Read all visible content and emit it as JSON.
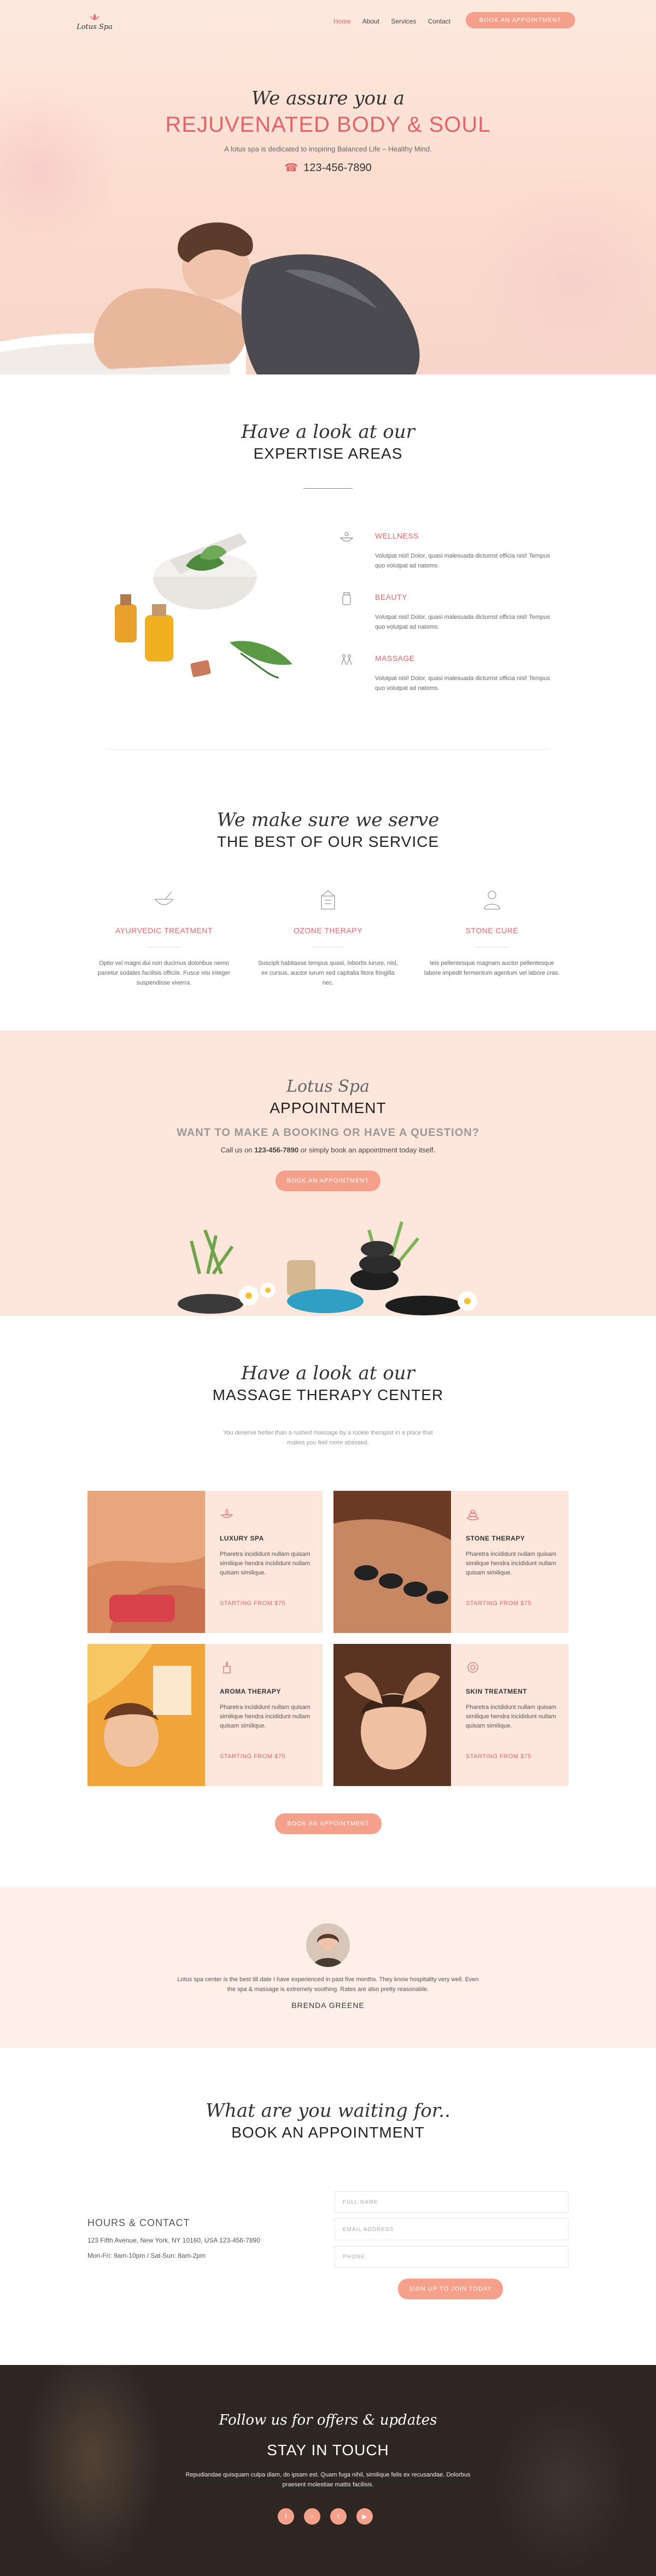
{
  "nav": {
    "logo_text": "Lotus Spa",
    "links": [
      "Home",
      "About",
      "Services",
      "Contact"
    ],
    "cta": "BOOK AN APPOINTMENT"
  },
  "hero": {
    "script": "We assure you a",
    "title": "REJUVENATED BODY & SOUL",
    "tagline": "A lotus spa is dedicated to inspiring Balanced Life – Healthy Mind.",
    "phone": "123-456-7890"
  },
  "expertise": {
    "script": "Have a look at our",
    "title": "EXPERTISE AREAS",
    "items": [
      {
        "title": "WELLNESS",
        "text": "Volutpat nisl! Dolor, quasi malesuada dictumst officia nisl! Tempus quo volutpat ad natoms."
      },
      {
        "title": "BEAUTY",
        "text": "Volutpat nisl! Dolor, quasi malesuada dictumst officia nisl! Tempus quo volutpat ad natoms."
      },
      {
        "title": "MASSAGE",
        "text": "Volutpat nisl! Dolor, quasi malesuada dictumst officia nisl! Tempus quo volutpat ad natoms."
      }
    ]
  },
  "best": {
    "script": "We make sure we serve",
    "title": "THE BEST OF OUR SERVICE",
    "items": [
      {
        "title": "AYURVEDIC TREATMENT",
        "text": "Optio vel magni dui non ducimus doloribus nemo parietur sodales facilisis officiis. Fusce nisi integer suspendisse viverra."
      },
      {
        "title": "OZONE THERAPY",
        "text": "Suscipit habitasse tempus quasi, lobortis iurure, nisl, ex cursus, auctor iurum sed capitalia litora fringilla nec."
      },
      {
        "title": "STONE CURE",
        "text": "Ieis pellentesque magnam auctor pellentesque labore impedit fermentum agentum vel labore cras."
      }
    ]
  },
  "appointment": {
    "script": "Lotus Spa",
    "title": "APPOINTMENT",
    "question": "WANT TO MAKE A BOOKING OR HAVE A QUESTION?",
    "line_pre": "Call us on",
    "line_phone": "123-456-7890",
    "line_post": "or simply book an appointment today itself.",
    "cta": "BOOK AN APPOINTMENT"
  },
  "massage": {
    "script": "Have a look at our",
    "title": "MASSAGE THERAPY CENTER",
    "subtitle": "You deserve better than a rushed massage by a rookie therapist in a place that makes you feel more stressed.",
    "tiles": [
      {
        "title": "LUXURY SPA",
        "text": "Pharetra incididunt nullam quisam similique hendra incididunt nullam quisam similique.",
        "price": "STARTING FROM $75"
      },
      {
        "title": "STONE THERAPY",
        "text": "Pharetra incididunt nullam quisam similique hendra incididunt nullam quisam similique.",
        "price": "STARTING FROM $75"
      },
      {
        "title": "AROMA THERAPY",
        "text": "Pharetra incididunt nullam quisam similique hendra incididunt nullam quisam similique.",
        "price": "STARTING FROM $75"
      },
      {
        "title": "SKIN TREATMENT",
        "text": "Pharetra incididunt nullam quisam similique hendra incididunt nullam quisam similique.",
        "price": "STARTING FROM $75"
      }
    ],
    "cta": "BOOK AN APPOINTMENT"
  },
  "testimonial": {
    "quote": "Lotus spa center is the best till date I have experienced in past five months. They know hospitality very well. Even the spa & massage is extremely soothing. Rates are also pretty reasonable.",
    "name": "BRENDA GREENE"
  },
  "book": {
    "script": "What are you waiting for..",
    "title": "BOOK AN APPOINTMENT",
    "hours_title": "HOURS & CONTACT",
    "address": "123 Fifth Avenue, New York, NY 10160, USA 123-456-7890",
    "hours": "Mon-Fri: 9am-10pm / Sat-Sun: 8am-2pm",
    "fields": [
      "FULL NAME",
      "EMAIL ADDRESS",
      "PHONE"
    ],
    "cta": "SIGN UP TO JOIN TODAY"
  },
  "footer": {
    "script": "Follow us for offers & updates",
    "title": "STAY IN TOUCH",
    "text": "Repudiandae quisquam culpa diam, do ipsam est. Quam fuga nihil, similique felis ex recusandae. Dolorbus praesent molestiae mattis facilisis.",
    "socials": [
      "facebook-icon",
      "instagram-icon",
      "twitter-icon",
      "youtube-icon"
    ]
  },
  "colors": {
    "accent": "#e2646b",
    "button": "#f5a08a",
    "blush": "#fde6dc",
    "footer": "#2d2623"
  }
}
